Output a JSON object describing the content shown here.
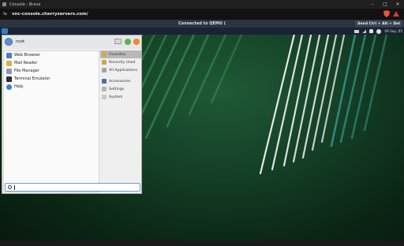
{
  "browser": {
    "window_title": "Console - Brave",
    "url": "vnc-console.cherryservers.com/",
    "controls": {
      "minimize": "–",
      "maximize": "□",
      "close": "✕"
    },
    "icons": [
      "site-info-icon",
      "brave-shield-icon",
      "warning-icon"
    ]
  },
  "vnc": {
    "status": "Connected to QEMU (",
    "send_cad_label": "Send Ctrl + Alt + Del"
  },
  "panel": {
    "clock": "09 Sep, 05"
  },
  "menu": {
    "username": "root",
    "favorites": [
      {
        "label": "Web Browser",
        "icon": "web-browser-icon",
        "color": "#4a7fc1"
      },
      {
        "label": "Mail Reader",
        "icon": "mail-reader-icon",
        "color": "#d9b34a"
      },
      {
        "label": "File Manager",
        "icon": "file-manager-icon",
        "color": "#8a9bb0"
      },
      {
        "label": "Terminal Emulator",
        "icon": "terminal-icon",
        "color": "#2e2e2e"
      },
      {
        "label": "Help",
        "icon": "help-icon",
        "color": "#3c7ed0"
      }
    ],
    "categories": [
      {
        "label": "Favorites",
        "icon": "favorites-icon",
        "color": "#d9a640",
        "selected": true
      },
      {
        "label": "Recently Used",
        "icon": "recent-icon",
        "color": "#c8a94a",
        "selected": false
      },
      {
        "label": "All Applications",
        "icon": "all-apps-icon",
        "color": "#9aa6b3",
        "selected": false
      },
      {
        "label": "Accessories",
        "icon": "accessories-icon",
        "color": "#4f6f9a",
        "selected": false
      },
      {
        "label": "Settings",
        "icon": "settings-icon",
        "color": "#b4b4b4",
        "selected": false
      },
      {
        "label": "System",
        "icon": "system-icon",
        "color": "#c9c9c9",
        "selected": false
      }
    ],
    "search": {
      "value": "",
      "placeholder": ""
    }
  },
  "colors": {
    "desktop_dark": "#0b2515",
    "desktop_light": "#1f5a35",
    "stripe_green": "#3fa35a",
    "stripe_white": "#f2f2f2",
    "stripe_teal": "#3aa8a0"
  }
}
